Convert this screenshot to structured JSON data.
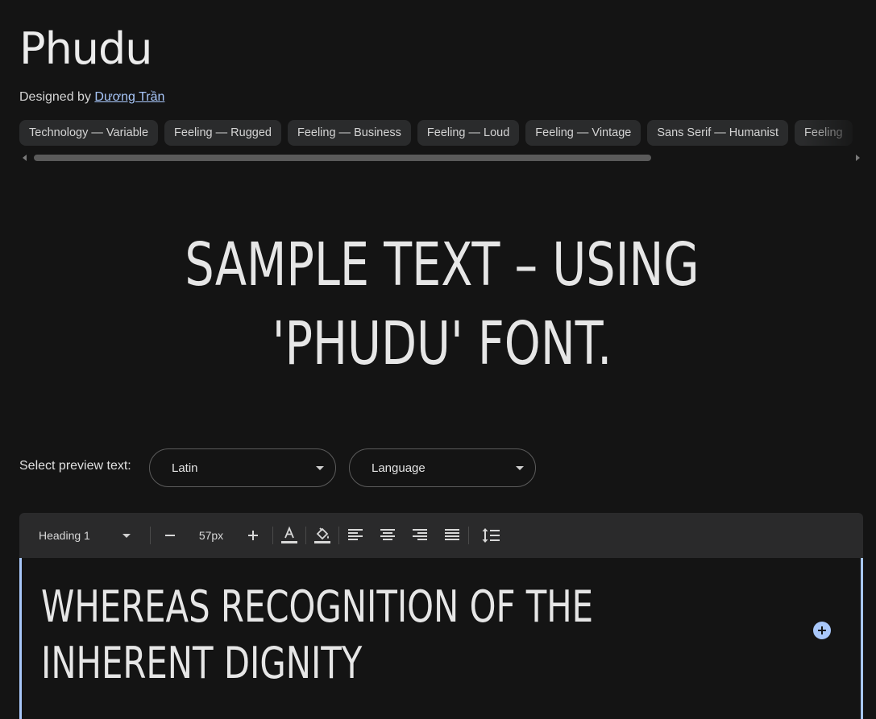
{
  "font": {
    "name": "Phudu",
    "designed_by_prefix": "Designed by ",
    "designer": "Dương Trần"
  },
  "tags": [
    "Technology — Variable",
    "Feeling — Rugged",
    "Feeling — Business",
    "Feeling — Loud",
    "Feeling — Vintage",
    "Sans Serif — Humanist",
    "Feeling"
  ],
  "sample_text": "SAMPLE TEXT – USING 'PHUDU' FONT.",
  "preview": {
    "label": "Select preview text:",
    "script_select": "Latin",
    "language_select": "Language"
  },
  "toolbar": {
    "style": "Heading 1",
    "size": "57px"
  },
  "editor": {
    "text": "WHEREAS RECOGNITION OF THE INHERENT DIGNITY"
  },
  "colors": {
    "background": "#141414",
    "accent": "#a8c7fa",
    "toolbar": "#2a2a2b",
    "chip": "#2a2b2c"
  }
}
